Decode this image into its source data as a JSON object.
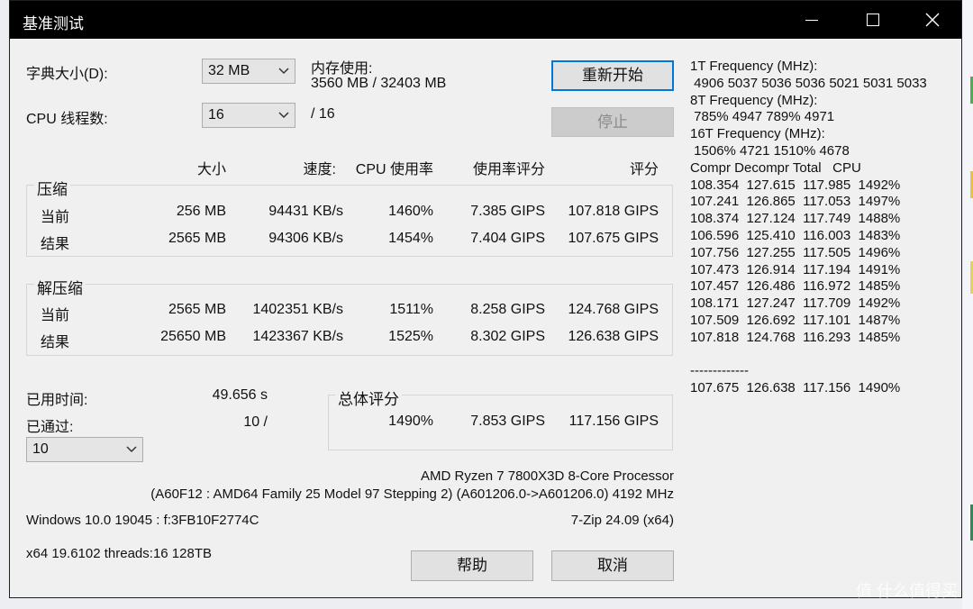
{
  "window": {
    "title": "基准测试",
    "controls": [
      "minimize-icon",
      "maximize-icon",
      "close-icon"
    ]
  },
  "dict": {
    "label": "字典大小(D):",
    "value": "32 MB"
  },
  "threads": {
    "label": "CPU 线程数:",
    "value": "16",
    "total": "/ 16"
  },
  "memory": {
    "label": "内存使用:",
    "value": "3560 MB / 32403 MB"
  },
  "buttons": {
    "restart": "重新开始",
    "stop": "停止",
    "help": "帮助",
    "cancel": "取消"
  },
  "columns": {
    "size": "大小",
    "speed": "速度:",
    "cpu": "CPU 使用率",
    "rating_usage": "使用率评分",
    "rating": "评分"
  },
  "compress": {
    "title": "压缩",
    "rows": [
      {
        "label": "当前",
        "size": "256 MB",
        "speed": "94431 KB/s",
        "cpu": "1460%",
        "usage": "7.385 GIPS",
        "rating": "107.818 GIPS"
      },
      {
        "label": "结果",
        "size": "2565 MB",
        "speed": "94306 KB/s",
        "cpu": "1454%",
        "usage": "7.404 GIPS",
        "rating": "107.675 GIPS"
      }
    ]
  },
  "decompress": {
    "title": "解压缩",
    "rows": [
      {
        "label": "当前",
        "size": "2565 MB",
        "speed": "1402351 KB/s",
        "cpu": "1511%",
        "usage": "8.258 GIPS",
        "rating": "124.768 GIPS"
      },
      {
        "label": "结果",
        "size": "25650 MB",
        "speed": "1423367 KB/s",
        "cpu": "1525%",
        "usage": "8.302 GIPS",
        "rating": "126.638 GIPS"
      }
    ]
  },
  "elapsed": {
    "label": "已用时间:",
    "value": "49.656 s"
  },
  "passes": {
    "label": "已通过:",
    "value": "10 /",
    "select": "10"
  },
  "total": {
    "title": "总体评分",
    "cpu": "1490%",
    "usage": "7.853 GIPS",
    "rating": "117.156 GIPS"
  },
  "cpuinfo": {
    "name": "AMD Ryzen 7 7800X3D 8-Core Processor",
    "detail": "(A60F12 : AMD64 Family 25 Model 97 Stepping 2) (A601206.0->A601206.0) 4192 MHz"
  },
  "os": "Windows 10.0 19045 : f:3FB10F2774C",
  "version": "7-Zip 24.09 (x64)",
  "build": "x64 19.6102 threads:16 128TB",
  "log": [
    "1T Frequency (MHz):",
    " 4906 5037 5036 5036 5021 5031 5033",
    "8T Frequency (MHz):",
    " 785% 4947 789% 4971",
    "16T Frequency (MHz):",
    " 1506% 4721 1510% 4678",
    "Compr Decompr Total   CPU",
    "108.354  127.615  117.985  1492%",
    "107.241  126.865  117.053  1497%",
    "108.374  127.124  117.749  1488%",
    "106.596  125.410  116.003  1483%",
    "107.756  127.255  117.505  1496%",
    "107.473  126.914  117.194  1491%",
    "107.457  126.486  116.972  1485%",
    "108.171  127.247  117.709  1492%",
    "107.509  126.692  117.101  1487%",
    "107.818  124.768  116.293  1485%",
    "",
    "-------------",
    "107.675  126.638  117.156  1490%"
  ],
  "watermark": "值 什么值得买",
  "colors": {
    "titlebar": "#000000",
    "dialog_bg": "#f0f0f0",
    "accent": "#0078d7"
  }
}
